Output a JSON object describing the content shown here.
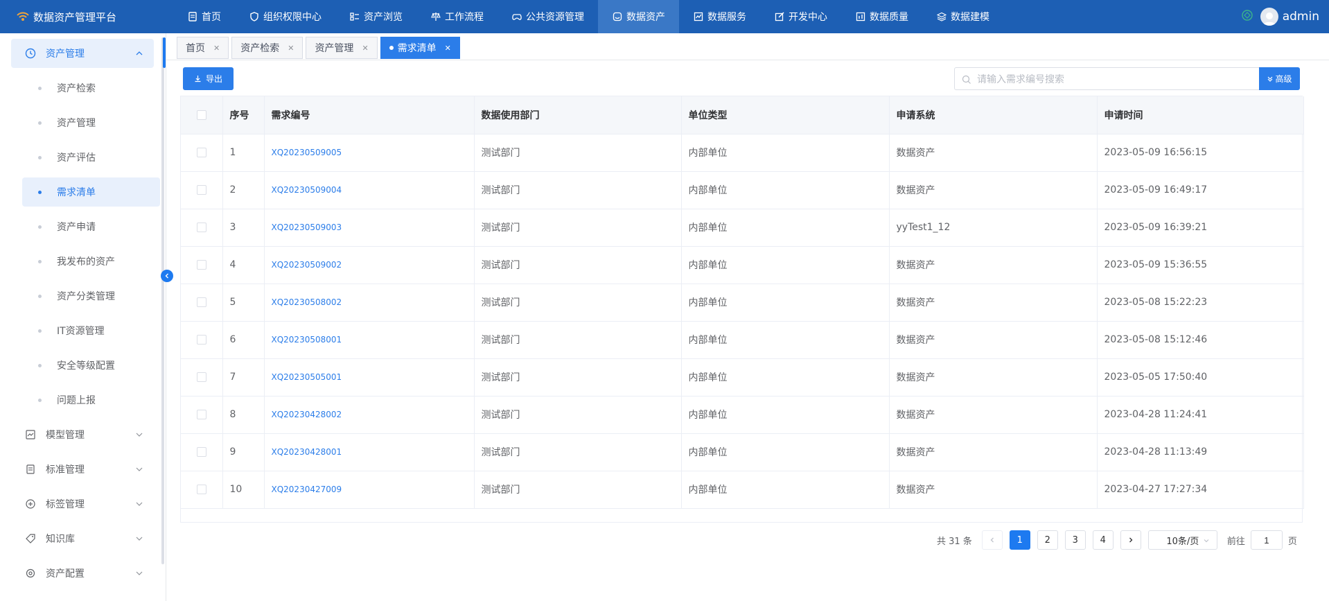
{
  "app": {
    "title": "数据资产管理平台"
  },
  "nav": [
    {
      "label": "首页",
      "icon": "document-icon"
    },
    {
      "label": "组织权限中心",
      "icon": "shield-icon"
    },
    {
      "label": "资产浏览",
      "icon": "list-icon"
    },
    {
      "label": "工作流程",
      "icon": "scale-icon"
    },
    {
      "label": "公共资源管理",
      "icon": "gamepad-icon"
    },
    {
      "label": "数据资产",
      "icon": "database-icon",
      "active": true
    },
    {
      "label": "数据服务",
      "icon": "chart-icon"
    },
    {
      "label": "开发中心",
      "icon": "edit-icon"
    },
    {
      "label": "数据质量",
      "icon": "bar-chart-icon"
    },
    {
      "label": "数据建模",
      "icon": "layers-icon"
    }
  ],
  "user": {
    "name": "admin"
  },
  "sidebar": {
    "group": {
      "label": "资产管理",
      "icon": "clock-icon"
    },
    "items": [
      {
        "label": "资产检索"
      },
      {
        "label": "资产管理"
      },
      {
        "label": "资产评估"
      },
      {
        "label": "需求清单",
        "active": true
      },
      {
        "label": "资产申请"
      },
      {
        "label": "我发布的资产"
      },
      {
        "label": "资产分类管理"
      },
      {
        "label": "IT资源管理"
      },
      {
        "label": "安全等级配置"
      },
      {
        "label": "问题上报"
      }
    ],
    "menus": [
      {
        "label": "模型管理",
        "icon": "trend-icon"
      },
      {
        "label": "标准管理",
        "icon": "doc-icon"
      },
      {
        "label": "标签管理",
        "icon": "plus-circle-icon"
      },
      {
        "label": "知识库",
        "icon": "tag-icon"
      },
      {
        "label": "资产配置",
        "icon": "settings-icon"
      }
    ]
  },
  "tabs": [
    {
      "label": "首页"
    },
    {
      "label": "资产检索"
    },
    {
      "label": "资产管理"
    },
    {
      "label": "需求清单",
      "active": true
    }
  ],
  "toolbar": {
    "export_label": "导出",
    "search_placeholder": "请输入需求编号搜索",
    "advanced_label": "高级"
  },
  "table": {
    "headers": [
      "序号",
      "需求编号",
      "数据使用部门",
      "单位类型",
      "申请系统",
      "申请时间"
    ],
    "rows": [
      [
        "1",
        "XQ20230509005",
        "测试部门",
        "内部单位",
        "数据资产",
        "2023-05-09 16:56:15"
      ],
      [
        "2",
        "XQ20230509004",
        "测试部门",
        "内部单位",
        "数据资产",
        "2023-05-09 16:49:17"
      ],
      [
        "3",
        "XQ20230509003",
        "测试部门",
        "内部单位",
        "yyTest1_12",
        "2023-05-09 16:39:21"
      ],
      [
        "4",
        "XQ20230509002",
        "测试部门",
        "内部单位",
        "数据资产",
        "2023-05-09 15:36:55"
      ],
      [
        "5",
        "XQ20230508002",
        "测试部门",
        "内部单位",
        "数据资产",
        "2023-05-08 15:22:23"
      ],
      [
        "6",
        "XQ20230508001",
        "测试部门",
        "内部单位",
        "数据资产",
        "2023-05-08 15:12:46"
      ],
      [
        "7",
        "XQ20230505001",
        "测试部门",
        "内部单位",
        "数据资产",
        "2023-05-05 17:50:40"
      ],
      [
        "8",
        "XQ20230428002",
        "测试部门",
        "内部单位",
        "数据资产",
        "2023-04-28 11:24:41"
      ],
      [
        "9",
        "XQ20230428001",
        "测试部门",
        "内部单位",
        "数据资产",
        "2023-04-28 11:13:49"
      ],
      [
        "10",
        "XQ20230427009",
        "测试部门",
        "内部单位",
        "数据资产",
        "2023-04-27 17:27:34"
      ]
    ]
  },
  "pagination": {
    "total_label": "共 31 条",
    "pages": [
      "1",
      "2",
      "3",
      "4"
    ],
    "current": "1",
    "page_size_label": "10条/页",
    "goto_prefix": "前往",
    "goto_value": "1",
    "goto_suffix": "页"
  },
  "colors": {
    "primary": "#2b7de9",
    "header": "#1d5fb4",
    "nav_active": "#3a78c6"
  }
}
